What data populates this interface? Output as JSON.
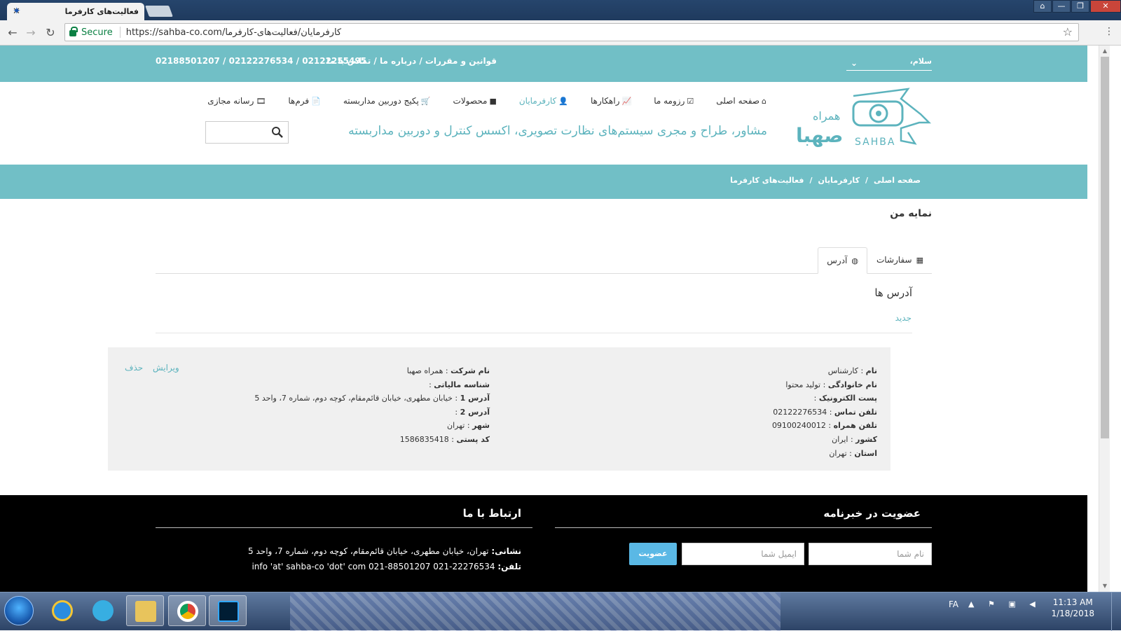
{
  "browser": {
    "tab_title": "فعالیت‌های کارفرما",
    "secure_label": "Secure",
    "url": "https://sahba-co.com/کارفرمایان/فعالیت‌های-کارفرما"
  },
  "topbar": {
    "links": "قوانین و مقررات / درباره ما / تماس با ما",
    "phones": "02122255495 / 02122276534 / 02188501207",
    "greeting": "سلام،"
  },
  "logo": {
    "text_fa": "همراه صهبا",
    "text_en": "SAHBA"
  },
  "nav": {
    "items": [
      {
        "label": "صفحه اصلی",
        "icon": "home-icon",
        "glyph": "⌂"
      },
      {
        "label": "رزومه ما",
        "icon": "check-square-icon",
        "glyph": "☑"
      },
      {
        "label": "راهکارها",
        "icon": "line-chart-icon",
        "glyph": "📈"
      },
      {
        "label": "کارفرمایان",
        "icon": "user-icon",
        "glyph": "👤"
      },
      {
        "label": "محصولات",
        "icon": "video-camera-icon",
        "glyph": "■"
      },
      {
        "label": "پکیج دوربین مداربسته",
        "icon": "cart-icon",
        "glyph": "🛒"
      },
      {
        "label": "فرم‌ها",
        "icon": "file-icon",
        "glyph": "📄"
      },
      {
        "label": "رسانه مجازی",
        "icon": "film-icon",
        "glyph": "🎞"
      }
    ],
    "active_index": 3
  },
  "tagline": "مشاور، طراح و مجری سیستم‌های نظارت تصویری، اکسس کنترل و دوربین مداربسته",
  "breadcrumb": [
    "صفحه اصلی",
    "کارفرمایان",
    "فعالیت‌های کارفرما"
  ],
  "page_title": "نمایه من",
  "tabs": {
    "orders": "سفارشات",
    "address": "آدرس"
  },
  "addresses": {
    "title": "آدرس ها",
    "new_link": "جدید",
    "card": {
      "col1": [
        {
          "label": "نام",
          "value": "کارشناس"
        },
        {
          "label": "نام خانوادگی",
          "value": "تولید محتوا"
        },
        {
          "label": "پست الکترونیک",
          "value": ""
        },
        {
          "label": "تلفن تماس",
          "value": "02122276534"
        },
        {
          "label": "تلفن همراه",
          "value": "09100240012"
        },
        {
          "label": "کشور",
          "value": "ایران"
        },
        {
          "label": "استان",
          "value": "تهران"
        }
      ],
      "col2": [
        {
          "label": "نام شرکت",
          "value": "همراه صهبا"
        },
        {
          "label": "شناسه مالیاتی",
          "value": ""
        },
        {
          "label": "آدرس 1",
          "value": "خیابان مطهری، خیابان قائم‌مقام، کوچه دوم، شماره 7، واحد 5"
        },
        {
          "label": "آدرس 2",
          "value": ""
        },
        {
          "label": "شهر",
          "value": "تهران"
        },
        {
          "label": "کد پستی",
          "value": "1586835418"
        }
      ],
      "edit": "ویرایش",
      "delete": "حذف"
    }
  },
  "footer": {
    "newsletter_title": "عضویت در خبرنامه",
    "name_placeholder": "نام شما",
    "email_placeholder": "ایمیل شما",
    "subscribe": "عضویت",
    "contact_title": "ارتباط با ما",
    "address_label": "نشانی:",
    "address_value": "تهران، خیابان مطهری، خیابان قائم‌مقام، کوچه دوم، شماره 7، واحد 5",
    "phone_label": "تلفن:",
    "phone_value": "22276534-021  88501207-021  info 'at' sahba-co 'dot' com"
  },
  "taskbar": {
    "lang": "FA",
    "time": "11:13 AM",
    "date": "1/18/2018"
  },
  "colors": {
    "teal": "#71bfc6",
    "accent": "#5cb3bd",
    "button": "#5ab8e5"
  }
}
